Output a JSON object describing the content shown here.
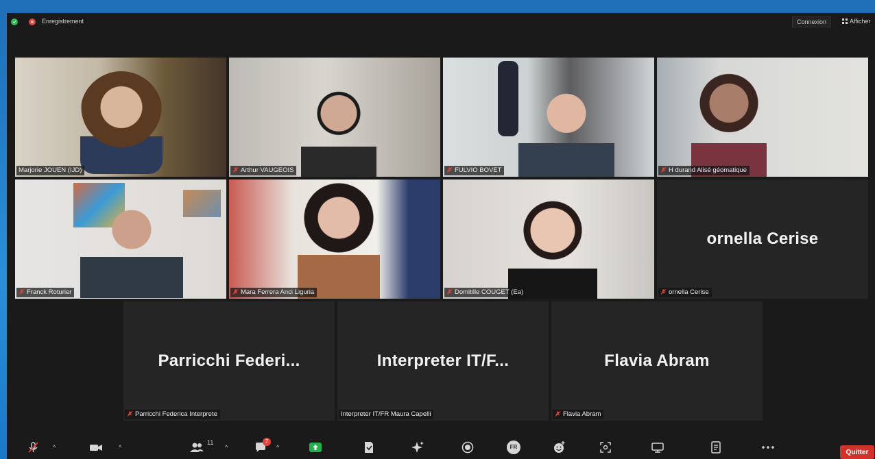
{
  "topbar": {
    "recording_label": "Enregistrement",
    "connexion_label": "Connexion",
    "afficher_label": "Afficher"
  },
  "participants": [
    {
      "name": "Marjorie JOUEN (IJD)",
      "video": true,
      "muted": false,
      "active_speaker": true
    },
    {
      "name": "Arthur VAUGEOIS",
      "video": true,
      "muted": true
    },
    {
      "name": "FULVIO BOVET",
      "video": true,
      "muted": true
    },
    {
      "name": "H durand Alisé géomatique",
      "video": true,
      "muted": true
    },
    {
      "name": "Franck Roturier",
      "video": true,
      "muted": true
    },
    {
      "name": "Mara Ferrera Anci Liguria",
      "video": true,
      "muted": true
    },
    {
      "name": "Domitille COUGET (Ea)",
      "video": true,
      "muted": true
    },
    {
      "name": "ornella Cerise",
      "display": "ornella Cerise",
      "video": false,
      "muted": true
    },
    {
      "name": "Parricchi Federica Interprete",
      "display": "Parricchi  Federi...",
      "video": false,
      "muted": true
    },
    {
      "name": "Interpreter IT/FR Maura Capelli",
      "display": "Interpreter  IT/F...",
      "video": false,
      "muted": false
    },
    {
      "name": "Flavia Abram",
      "display": "Flavia Abram",
      "video": false,
      "muted": true
    }
  ],
  "toolbar": {
    "participants_count": "11",
    "chat_badge": "7",
    "language_label": "FR",
    "quit_label": "Quitter",
    "icons": [
      "mic-muted-icon",
      "video-icon",
      "participants-icon",
      "chat-icon",
      "share-screen-icon",
      "notes-icon",
      "ai-companion-icon",
      "record-icon",
      "interpretation-icon",
      "reactions-icon",
      "apps-icon",
      "whiteboard-icon",
      "summary-icon",
      "more-icon"
    ]
  },
  "colors": {
    "active_border": "#c8e35a",
    "muted_mic": "#e0443a",
    "share_green": "#22b14c",
    "quit_red": "#d1322c",
    "frame_blue": "#1a78c6"
  }
}
